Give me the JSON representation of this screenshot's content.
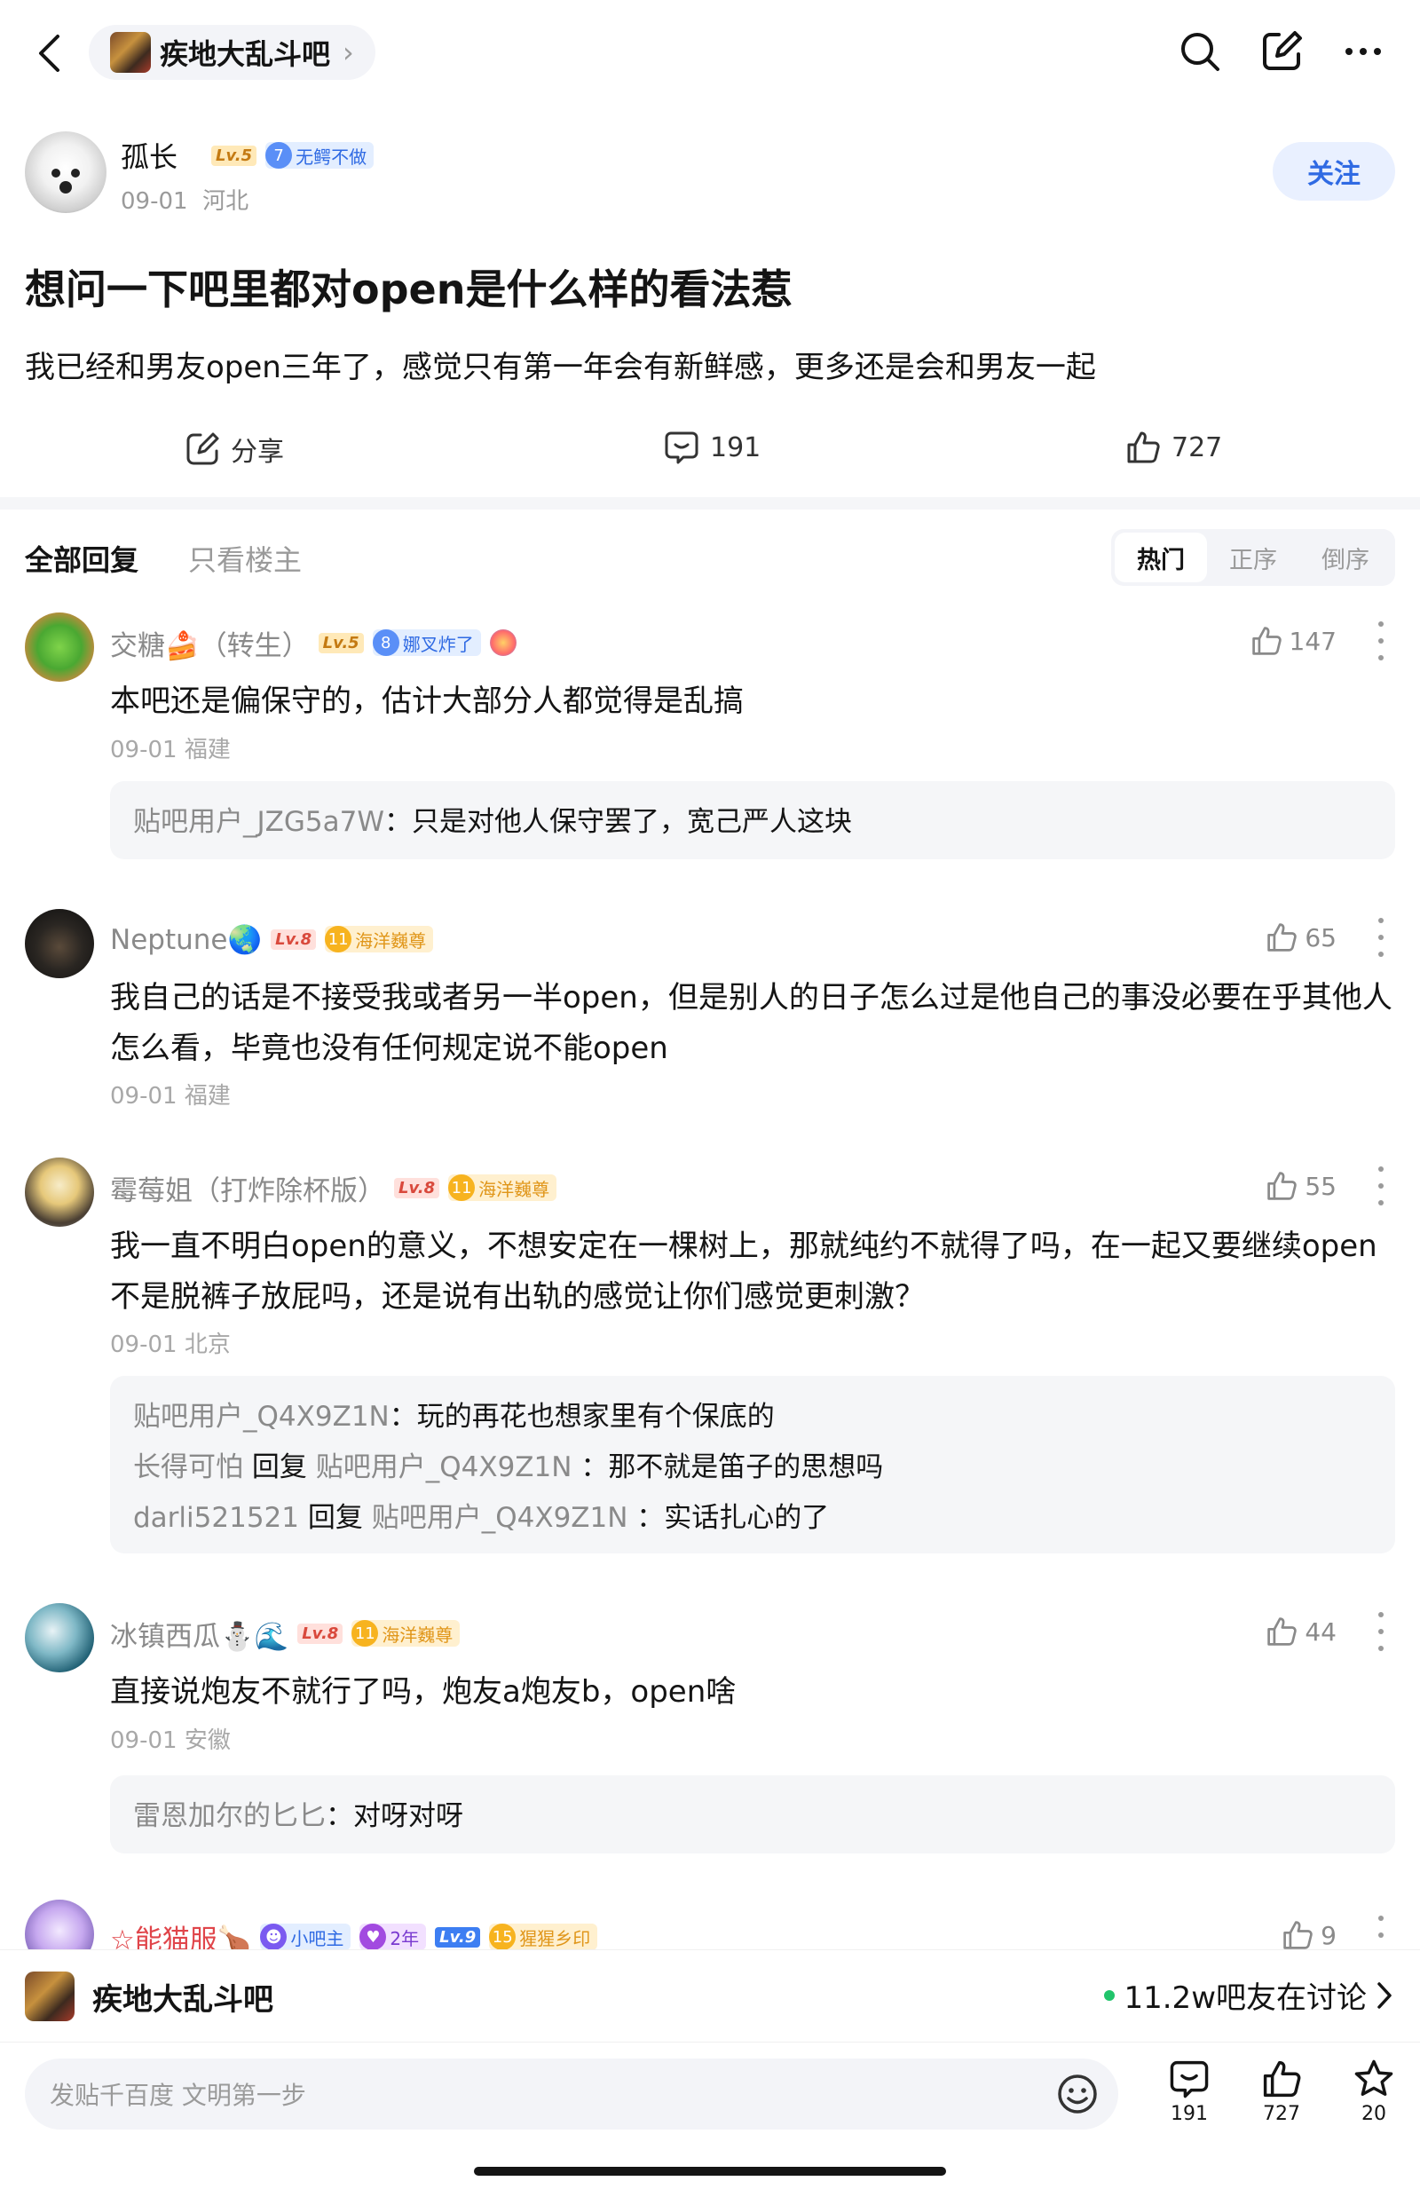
{
  "topbar": {
    "forum_name": "疾地大乱斗吧"
  },
  "post": {
    "author": {
      "name": "孤长",
      "level": "Lv.5",
      "tag_num": "7",
      "tag_label": "无鳄不做",
      "date": "09-01",
      "location": "河北",
      "follow_label": "关注"
    },
    "title": "想问一下吧里都对open是什么样的看法惹",
    "body": "我已经和男友open三年了，感觉只有第一年会有新鲜感，更多还是会和男友一起",
    "actions": {
      "share_label": "分享",
      "comment_count": "191",
      "like_count": "727"
    }
  },
  "reply_tabs": {
    "all_label": "全部回复",
    "op_only_label": "只看楼主",
    "sort": [
      "热门",
      "正序",
      "倒序"
    ]
  },
  "comments": [
    {
      "name": "交糖🍰（转生）",
      "level": "Lv.5",
      "tag_num": "8",
      "tag_label": "娜叉炸了",
      "likes": "147",
      "text": "本吧还是偏保守的，估计大部分人都觉得是乱搞",
      "date": "09-01 福建",
      "replies": [
        {
          "user": "贴吧用户_JZG5a7W",
          "sep": "：",
          "text": "只是对他人保守罢了，宽己严人这块"
        }
      ]
    },
    {
      "name": "Neptune🌏",
      "level": "Lv.8",
      "tag_num": "11",
      "tag_label": "海洋巍尊",
      "likes": "65",
      "text": "我自己的话是不接受我或者另一半open，但是别人的日子怎么过是他自己的事没必要在乎其他人怎么看，毕竟也没有任何规定说不能open",
      "date": "09-01 福建",
      "replies": []
    },
    {
      "name": "霉莓姐（打炸除杯版）",
      "level": "Lv.8",
      "tag_num": "11",
      "tag_label": "海洋巍尊",
      "likes": "55",
      "text": "我一直不明白open的意义，不想安定在一棵树上，那就纯约不就得了吗，在一起又要继续open不是脱裤子放屁吗，还是说有出轨的感觉让你们感觉更刺激？",
      "date": "09-01 北京",
      "replies": [
        {
          "user": "贴吧用户_Q4X9Z1N",
          "sep": "：",
          "text": "玩的再花也想家里有个保底的"
        },
        {
          "user": "长得可怕",
          "reply_word": "回复",
          "target": "贴吧用户_Q4X9Z1N",
          "sep": "：",
          "text": "那不就是笛子的思想吗"
        },
        {
          "user": "darli521521",
          "reply_word": "回复",
          "target": "贴吧用户_Q4X9Z1N",
          "sep": "：",
          "text": "实话扎心的了"
        }
      ]
    },
    {
      "name": "冰镇西瓜⛄🌊",
      "level": "Lv.8",
      "tag_num": "11",
      "tag_label": "海洋巍尊",
      "likes": "44",
      "text": "直接说炮友不就行了吗，炮友a炮友b，open啥",
      "date": "09-01 安徽",
      "replies": [
        {
          "user": "雷恩加尔的匕匕",
          "sep": "：",
          "text": "对呀对呀"
        }
      ]
    },
    {
      "name": "☆能猫服🍗",
      "tag_admin": "小吧主",
      "tag_years": "2年",
      "level": "Lv.9",
      "tag_num": "15",
      "tag_label": "猩猩乡印",
      "likes": "9"
    }
  ],
  "forum_bar": {
    "name": "疾地大乱斗吧",
    "online": "11.2w吧友在讨论"
  },
  "composer": {
    "placeholder": "发贴千百度 文明第一步",
    "comment_count": "191",
    "like_count": "727",
    "star_count": "20"
  },
  "colors": {
    "accent_blue": "#2f6ae3",
    "online_green": "#21c46b",
    "gold": "#f7b31f"
  }
}
